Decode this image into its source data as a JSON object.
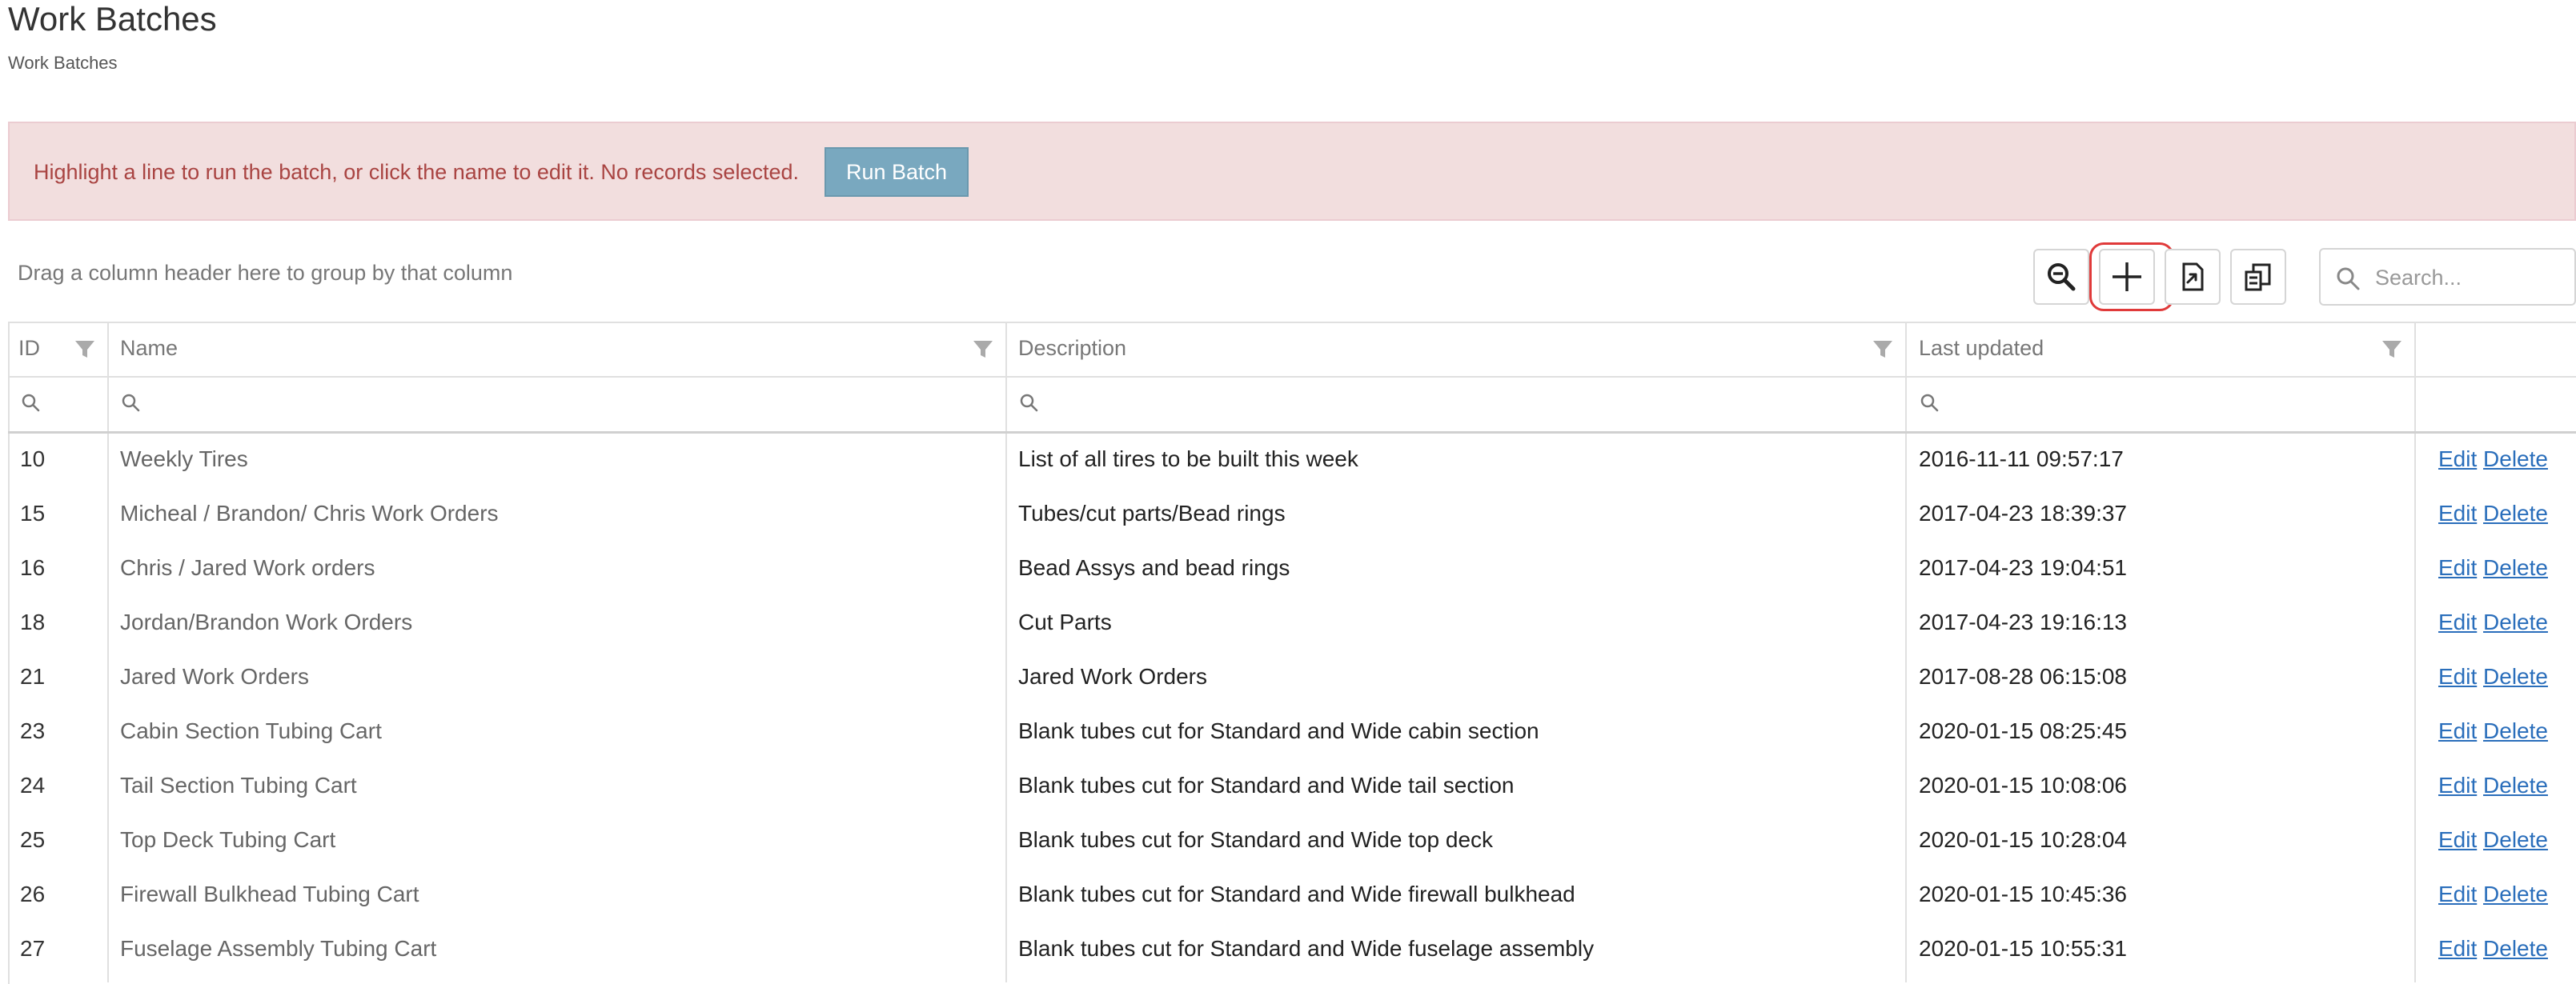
{
  "page": {
    "title": "Work Batches",
    "breadcrumb": "Work Batches"
  },
  "alert": {
    "message": "Highlight a line to run the batch, or click the name to edit it. No records selected.",
    "run_button": "Run Batch"
  },
  "toolbar": {
    "group_hint": "Drag a column header here to group by that column",
    "search_placeholder": "Search...",
    "buttons": [
      "zoom-out-icon",
      "plus-icon",
      "export-icon",
      "column-chooser-icon"
    ],
    "highlight_color": "#e03a3a"
  },
  "grid": {
    "columns": [
      "ID",
      "Name",
      "Description",
      "Last updated"
    ],
    "edit_label": "Edit",
    "delete_label": "Delete",
    "rows": [
      {
        "id": "10",
        "name": "Weekly Tires",
        "description": "List of all tires to be built this week",
        "updated": "2016-11-11 09:57:17"
      },
      {
        "id": "15",
        "name": "Micheal / Brandon/ Chris Work Orders",
        "description": "Tubes/cut parts/Bead rings",
        "updated": "2017-04-23 18:39:37"
      },
      {
        "id": "16",
        "name": "Chris / Jared Work orders",
        "description": "Bead Assys and bead rings",
        "updated": "2017-04-23 19:04:51"
      },
      {
        "id": "18",
        "name": "Jordan/Brandon Work Orders",
        "description": "Cut Parts",
        "updated": "2017-04-23 19:16:13"
      },
      {
        "id": "21",
        "name": "Jared Work Orders",
        "description": "Jared Work Orders",
        "updated": "2017-08-28 06:15:08"
      },
      {
        "id": "23",
        "name": "Cabin Section Tubing Cart",
        "description": "Blank tubes cut for Standard and Wide cabin section",
        "updated": "2020-01-15 08:25:45"
      },
      {
        "id": "24",
        "name": "Tail Section Tubing Cart",
        "description": "Blank tubes cut for Standard and Wide tail section",
        "updated": "2020-01-15 10:08:06"
      },
      {
        "id": "25",
        "name": "Top Deck Tubing Cart",
        "description": "Blank tubes cut for Standard and Wide top deck",
        "updated": "2020-01-15 10:28:04"
      },
      {
        "id": "26",
        "name": "Firewall Bulkhead Tubing Cart",
        "description": "Blank tubes cut for Standard and Wide firewall bulkhead",
        "updated": "2020-01-15 10:45:36"
      },
      {
        "id": "27",
        "name": "Fuselage Assembly Tubing Cart",
        "description": "Blank tubes cut for Standard and Wide fuselage assembly",
        "updated": "2020-01-15 10:55:31"
      }
    ]
  }
}
